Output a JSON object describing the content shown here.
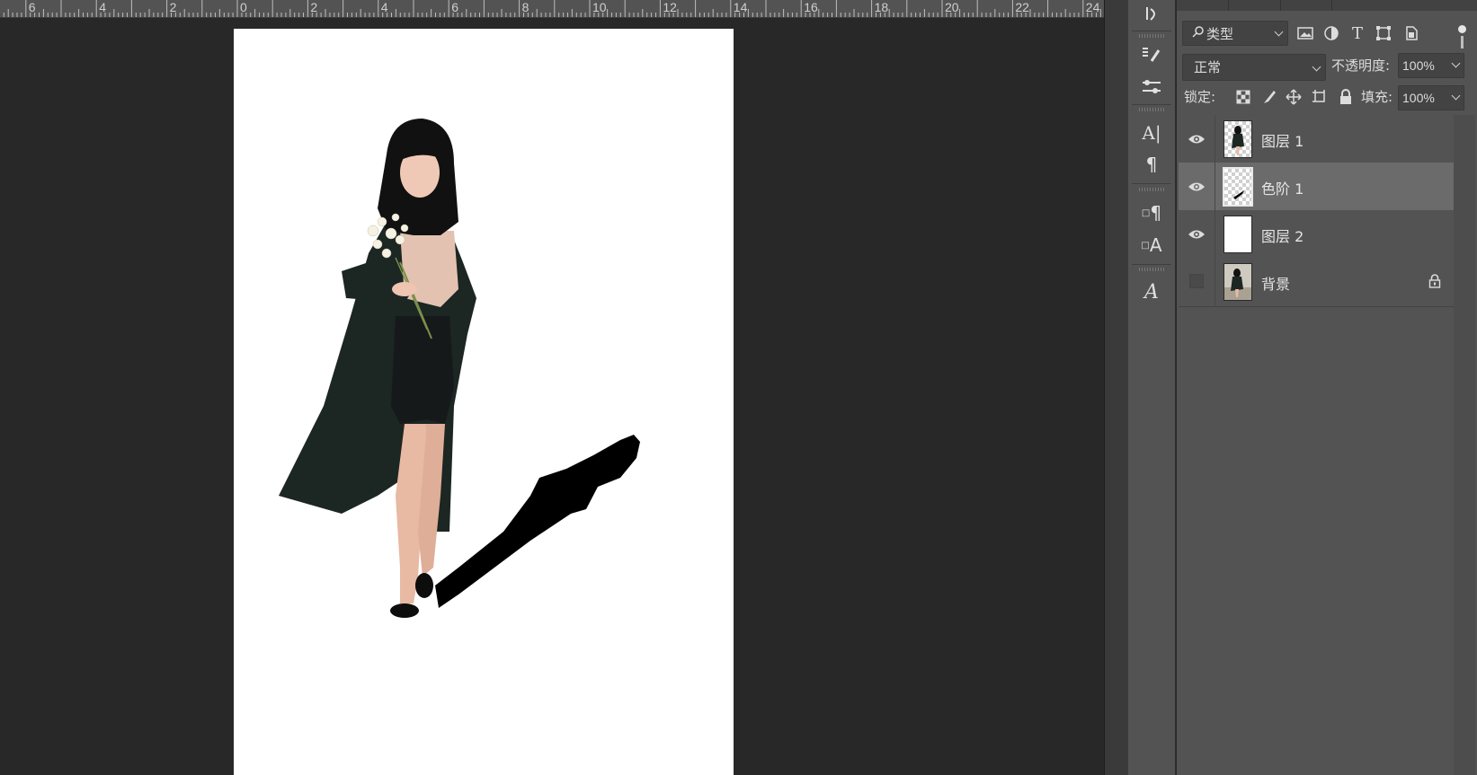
{
  "ruler": {
    "labels": [
      "6",
      "4",
      "2",
      "0",
      "2",
      "4",
      "6",
      "8",
      "10",
      "12",
      "14",
      "16",
      "18",
      "20",
      "22",
      "24"
    ]
  },
  "toolstrip": {
    "tools": [
      {
        "name": "history-brush-icon",
        "glyph": "↻"
      },
      {
        "name": "brush-presets-icon",
        "glyph": "✎"
      },
      {
        "name": "adjustments-icon",
        "glyph": "⚙"
      },
      {
        "name": "character-icon",
        "glyph": "A|"
      },
      {
        "name": "paragraph-icon",
        "glyph": "¶"
      },
      {
        "name": "paragraph-styles-icon",
        "glyph": "¶"
      },
      {
        "name": "character-styles-icon",
        "glyph": "A"
      },
      {
        "name": "glyphs-icon",
        "glyph": "𝒜"
      }
    ]
  },
  "layers_panel": {
    "kind_filter": "类型",
    "blend_mode": "正常",
    "opacity_label": "不透明度:",
    "opacity_value": "100%",
    "lock_label": "锁定:",
    "fill_label": "填充:",
    "fill_value": "100%",
    "layers": [
      {
        "name": "图层 1",
        "visible": true,
        "selected": false,
        "thumb": "person-transparent",
        "locked": false
      },
      {
        "name": "色阶 1",
        "visible": true,
        "selected": true,
        "thumb": "shadow-mask",
        "locked": false
      },
      {
        "name": "图层 2",
        "visible": true,
        "selected": false,
        "thumb": "white",
        "locked": false
      },
      {
        "name": "背景",
        "visible": false,
        "selected": false,
        "thumb": "photo",
        "locked": true
      }
    ]
  },
  "colors": {
    "workspace": "#282828",
    "panel": "#535353",
    "selected_layer": "#6b6b6b",
    "document": "#ffffff"
  }
}
